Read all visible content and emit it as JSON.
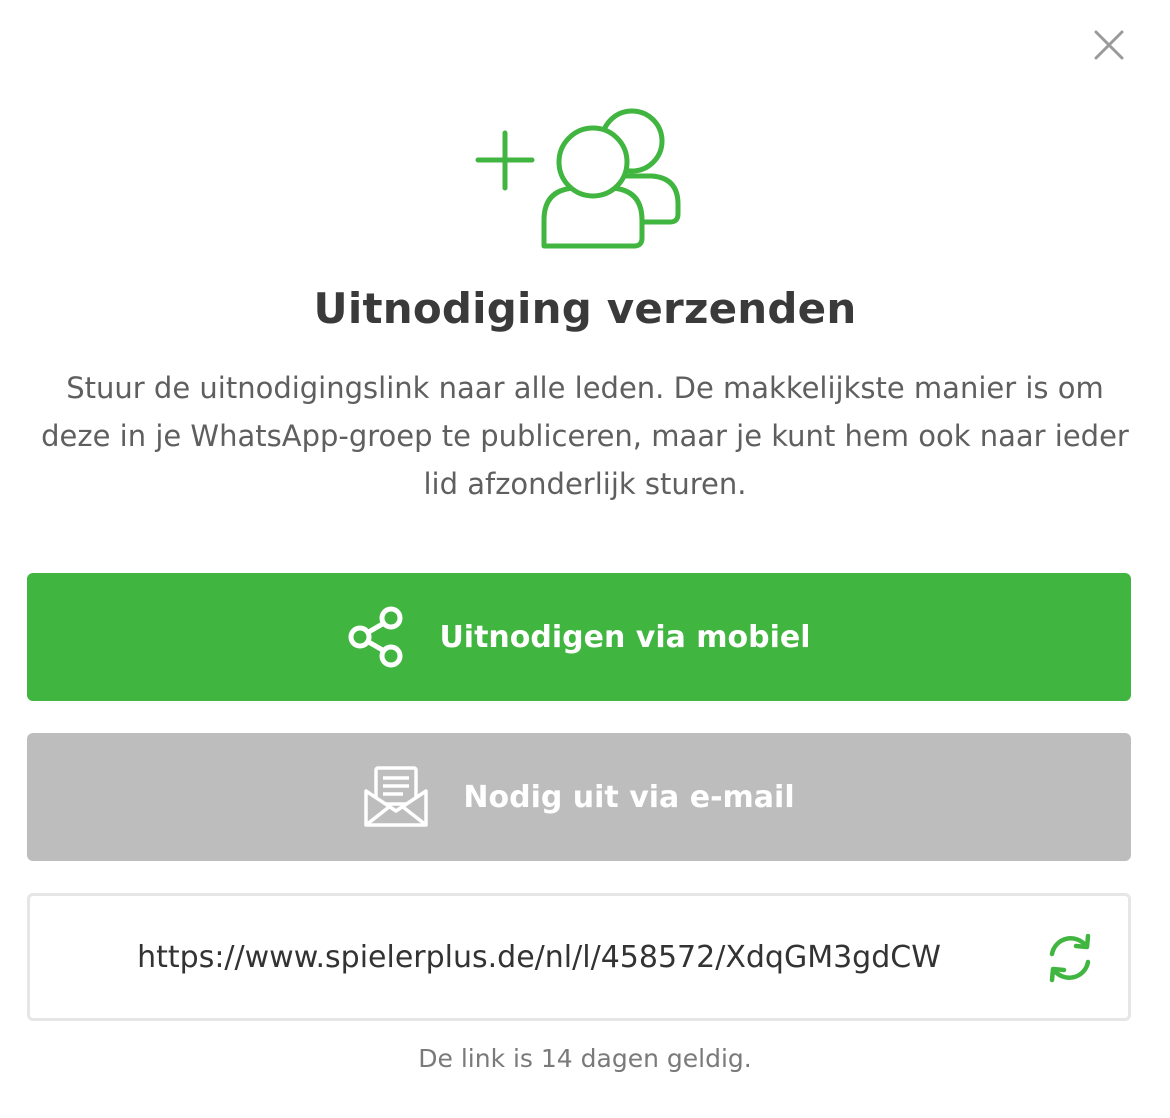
{
  "dialog": {
    "title": "Uitnodiging verzenden",
    "description": "Stuur de uitnodigingslink naar alle leden. De makkelijkste manier is om deze in je WhatsApp-groep te publiceren, maar je kunt hem ook naar ieder lid afzonderlijk sturen.",
    "icons": {
      "close": "close-icon",
      "hero": "add-users-icon",
      "share": "share-icon",
      "email": "envelope-icon",
      "refresh": "refresh-icon"
    }
  },
  "buttons": {
    "mobile_label": "Uitnodigen via mobiel",
    "email_label": "Nodig uit via e-mail"
  },
  "invite_link": {
    "url": "https://www.spielerplus.de/nl/l/458572/XdqGM3gdCW",
    "validity": "De link is 14 dagen geldig."
  },
  "colors": {
    "accent": "#40b53f",
    "disabled": "#bdbdbd",
    "title": "#3a3a3a",
    "text": "#5f5f5f"
  }
}
